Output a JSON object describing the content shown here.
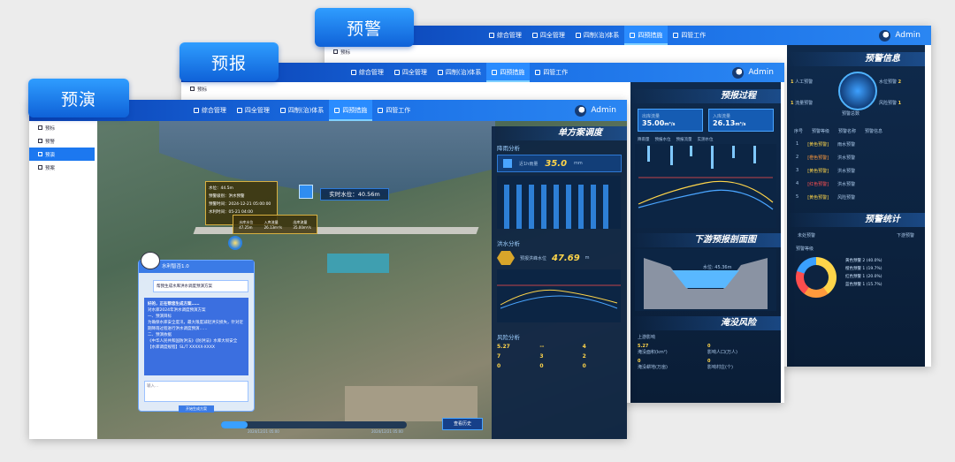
{
  "nav": [
    "综合管理",
    "四全管理",
    "四制(治)体系",
    "四预措施",
    "四管工作"
  ],
  "user": "Admin",
  "tabs": {
    "yujing": "预警",
    "yubao": "预报",
    "yuyan": "预演"
  },
  "sidebar": {
    "yujing": [
      "预标"
    ],
    "yubao": [
      "预标"
    ],
    "yuyan": [
      "预标",
      "预警",
      "预演",
      "预案"
    ]
  },
  "yujing_panel": {
    "info_title": "预警信息",
    "counts": [
      {
        "label": "人工预警",
        "value": "1"
      },
      {
        "label": "水位预警",
        "value": "2"
      },
      {
        "label": "流量预警",
        "value": "1"
      },
      {
        "label": "风险预警",
        "value": "1"
      }
    ],
    "center_label": "预警总数",
    "table_headers": [
      "序号",
      "预警等级",
      "预警名称",
      "预警信息"
    ],
    "rows": [
      {
        "no": "1",
        "level": "[黄色预警]",
        "name": "雨水预警"
      },
      {
        "no": "2",
        "level": "[橙色预警]",
        "name": "洪水预警"
      },
      {
        "no": "3",
        "level": "[黄色预警]",
        "name": "洪水预警"
      },
      {
        "no": "4",
        "level": "[红色预警]",
        "name": "洪水预警"
      },
      {
        "no": "5",
        "level": "[黄色预警]",
        "name": "风险预警"
      }
    ],
    "stats_title": "预警统计",
    "stat1": "未处预警",
    "stat2": "预警等级",
    "stat3": "下游预警",
    "legend": [
      "黄色预警 2 (40.0%)",
      "橙色预警 1 (19.7%)",
      "红色预警 1 (20.0%)",
      "蓝色预警 1 (15.7%)"
    ]
  },
  "yubao_panel": {
    "title": "预报过程",
    "in_label": "入库流量",
    "in_value": "26.13",
    "out_label": "出库流量",
    "out_value": "35.00",
    "unit": "m³/s",
    "legend": [
      "降雨量",
      "预报水位",
      "预报流量",
      "实测水位"
    ],
    "profile_title": "下游预报剖面图",
    "profile_val": "水位: 45.36m",
    "risk_title": "淹没风险",
    "risk_sub": "上游影响",
    "risk_nums": [
      "5.27",
      "0",
      "0",
      "0"
    ],
    "risk_labels": [
      "淹没面积(km²)",
      "影响人口(万人)",
      "淹没耕地(万亩)",
      "影响村庄(个)"
    ]
  },
  "yuyan_panel": {
    "title": "单方案调度",
    "rain_title": "降雨分析",
    "rain_label": "近1h雨量",
    "rain_value": "35.0",
    "rain_unit": "mm",
    "flood_title": "洪水分析",
    "flood_label": "预报洪峰水位",
    "flood_value": "47.69",
    "flood_unit": "m",
    "risk_title": "风险分析",
    "risk_nums": [
      "5.27",
      "--",
      "4",
      "7",
      "3",
      "2",
      "0",
      "0",
      "0"
    ],
    "realtime": "实时水位：40.56m",
    "info_rows": [
      "水位：44.5m",
      "预警级别：洪水预警",
      "预警时间：2024-12-21 05:00:00",
      "水利时间：05-21 04:00"
    ],
    "mini": [
      {
        "label": "水库水位",
        "value": "47.25m"
      },
      {
        "label": "入库流量",
        "value": "26.13m³/s"
      },
      {
        "label": "出库流量",
        "value": "35.00m³/s"
      }
    ],
    "chat_title": "水利智否1.0",
    "chat_question": "帮我生成水库洪水调度预演方案",
    "chat_answer_head": "好的，正在帮您生成方案……",
    "chat_lines": [
      "对水库2024年洪水调度预演方案",
      "一、预演目标",
      "为确保水库安全度汛，最大限度减轻洪灾损失，针对近期降雨过程进行洪水调度预演……",
      "二、预演依据",
      "《中华人民共和国防洪法》《防洪法》水库大坝安全",
      "【水库调度规程】SL/T XXXXX-XXXX"
    ],
    "chat_input": "输入...",
    "chat_button": "开始生成方案",
    "timeline_start": "2024/12/21 05:00",
    "timeline_end": "2024/12/21 05:00",
    "bottom_btn": "查看历史"
  }
}
